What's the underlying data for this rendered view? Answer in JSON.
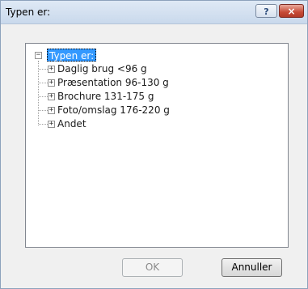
{
  "window": {
    "title": "Typen er:",
    "help_label": "?",
    "close_label": "×"
  },
  "tree": {
    "root": {
      "label": "Typen er:",
      "expander": "−"
    },
    "items": [
      {
        "label": "Daglig brug <96 g",
        "expander": "+"
      },
      {
        "label": "Præsentation 96-130 g",
        "expander": "+"
      },
      {
        "label": "Brochure 131-175 g",
        "expander": "+"
      },
      {
        "label": "Foto/omslag 176-220 g",
        "expander": "+"
      },
      {
        "label": "Andet",
        "expander": "+"
      }
    ]
  },
  "buttons": {
    "ok_label": "OK",
    "cancel_label": "Annuller"
  }
}
